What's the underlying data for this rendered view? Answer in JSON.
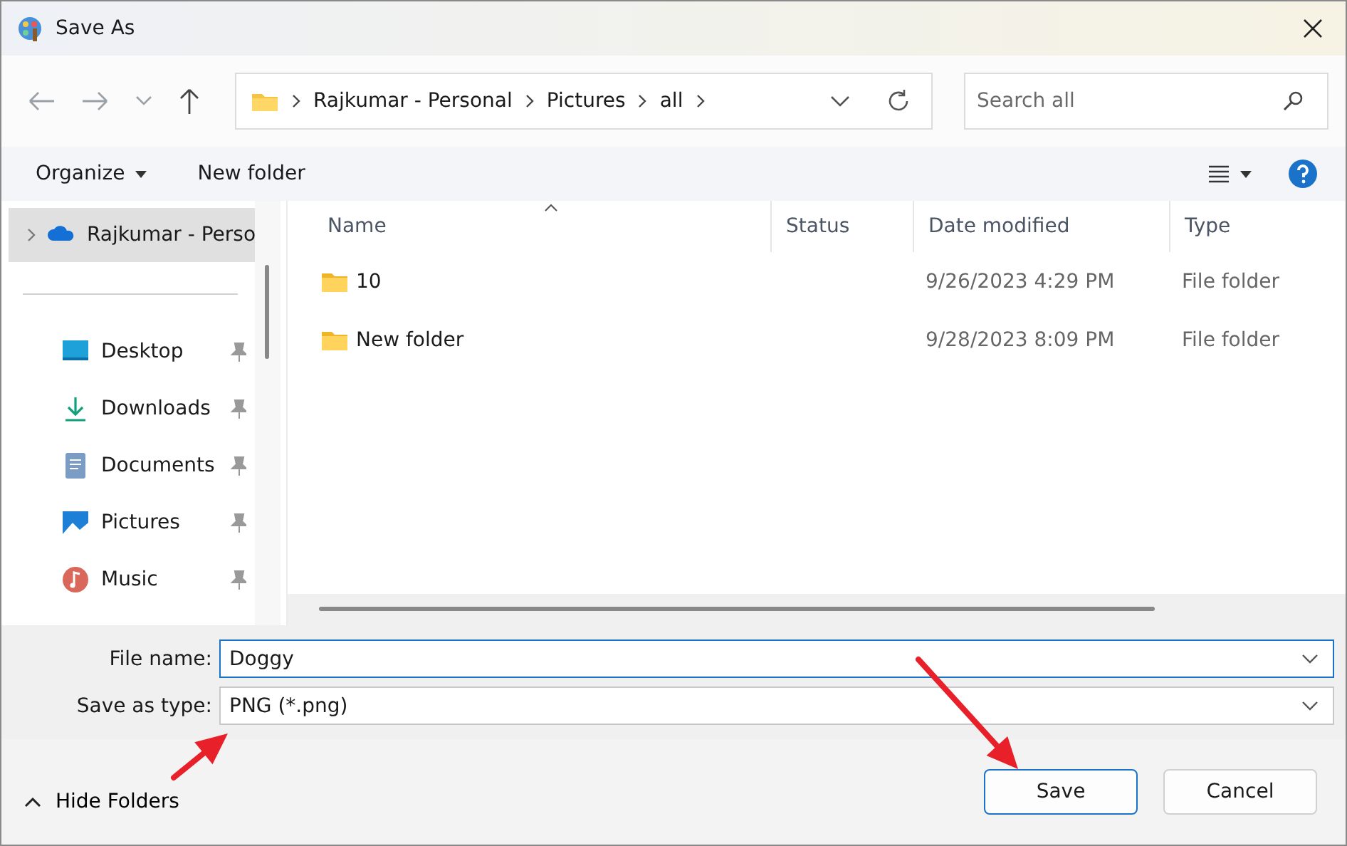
{
  "window": {
    "title": "Save As"
  },
  "address_bar": {
    "segments": [
      "Rajkumar - Personal",
      "Pictures",
      "all"
    ]
  },
  "search": {
    "placeholder": "Search all"
  },
  "toolbar": {
    "organize": "Organize",
    "new_folder": "New folder"
  },
  "sidebar": {
    "items": [
      {
        "label": "Rajkumar - Perso",
        "kind": "cloud",
        "selected": true
      },
      {
        "label": "Desktop",
        "kind": "desktop",
        "selected": false
      },
      {
        "label": "Downloads",
        "kind": "downloads",
        "selected": false
      },
      {
        "label": "Documents",
        "kind": "documents",
        "selected": false
      },
      {
        "label": "Pictures",
        "kind": "pictures",
        "selected": false
      },
      {
        "label": "Music",
        "kind": "music",
        "selected": false
      }
    ]
  },
  "file_list": {
    "columns": [
      "Name",
      "Status",
      "Date modified",
      "Type"
    ],
    "rows": [
      {
        "name": "10",
        "date_modified": "9/26/2023 4:29 PM",
        "type": "File folder"
      },
      {
        "name": "New folder",
        "date_modified": "9/28/2023 8:09 PM",
        "type": "File folder"
      }
    ]
  },
  "form": {
    "file_name": {
      "label": "File name:",
      "value": "Doggy"
    },
    "save_as_type": {
      "label": "Save as type:",
      "value": "PNG (*.png)"
    }
  },
  "footer": {
    "hide_folders": "Hide Folders",
    "buttons": [
      {
        "label": "Save",
        "kind": "primary"
      },
      {
        "label": "Cancel",
        "kind": "secondary"
      }
    ]
  },
  "annotations": [
    {
      "kind": "arrow"
    },
    {
      "kind": "arrow"
    }
  ]
}
